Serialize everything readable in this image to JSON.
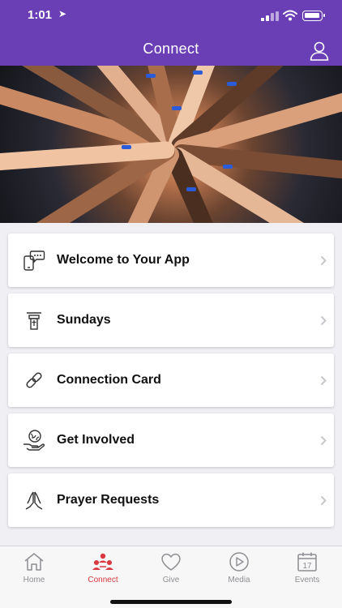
{
  "status_bar": {
    "time": "1:01",
    "location_arrow": "location-arrow-icon",
    "signal": "signal-bars-icon",
    "wifi": "wifi-icon",
    "battery": "battery-icon"
  },
  "header": {
    "title": "Connect",
    "profile_icon": "user-icon"
  },
  "hero": {
    "subject": "group of hands joined in a circle",
    "icon": "photo"
  },
  "menu": {
    "items": [
      {
        "label": "Welcome to Your App",
        "icon": "chat-phone-icon"
      },
      {
        "label": "Sundays",
        "icon": "pulpit-icon"
      },
      {
        "label": "Connection Card",
        "icon": "link-icon"
      },
      {
        "label": "Get Involved",
        "icon": "globe-hand-icon"
      },
      {
        "label": "Prayer Requests",
        "icon": "praying-hands-icon"
      }
    ],
    "chevron": "chevron-right-icon"
  },
  "tabs": [
    {
      "label": "Home",
      "icon": "home-icon",
      "active": false
    },
    {
      "label": "Connect",
      "icon": "people-icon",
      "active": true
    },
    {
      "label": "Give",
      "icon": "heart-icon",
      "active": false
    },
    {
      "label": "Media",
      "icon": "play-circle-icon",
      "active": false
    },
    {
      "label": "Events",
      "icon": "calendar-icon",
      "active": false,
      "calendar_day": "17"
    }
  ],
  "colors": {
    "header_bg": "#6a3fb6",
    "active_tab": "#d9383e",
    "inactive_tab": "#8e8e93",
    "page_bg": "#efeff4"
  }
}
